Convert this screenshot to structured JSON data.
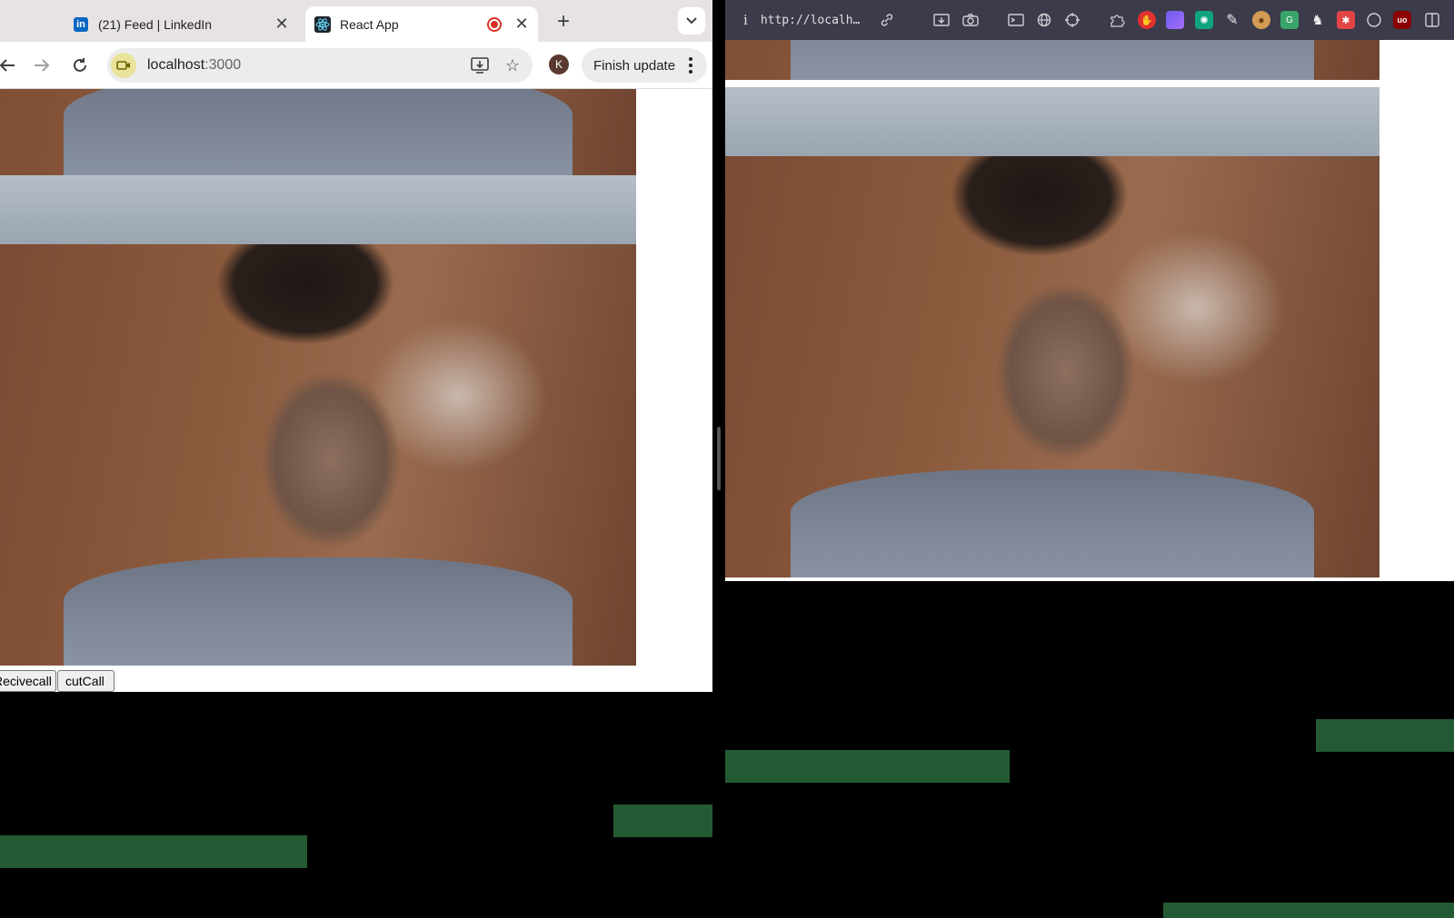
{
  "left_browser": {
    "tabs": [
      {
        "title": "(21) Feed | LinkedIn",
        "icon": "linkedin-icon",
        "active": false
      },
      {
        "title": "React App",
        "icon": "react-icon",
        "active": true,
        "recording": true
      }
    ],
    "address": {
      "host": "localhost",
      "port": ":3000"
    },
    "profile_initial": "K",
    "finish_update_label": "Finish update",
    "app": {
      "buttons": [
        {
          "label": "Recivecall"
        },
        {
          "label": "cutCall"
        }
      ]
    }
  },
  "right_browser": {
    "url_text": "http://localh…",
    "info_glyph": "i"
  },
  "colors": {
    "accent_green": "#235a33",
    "recording_red": "#d93025",
    "linkedin_blue": "#0a66c2"
  }
}
